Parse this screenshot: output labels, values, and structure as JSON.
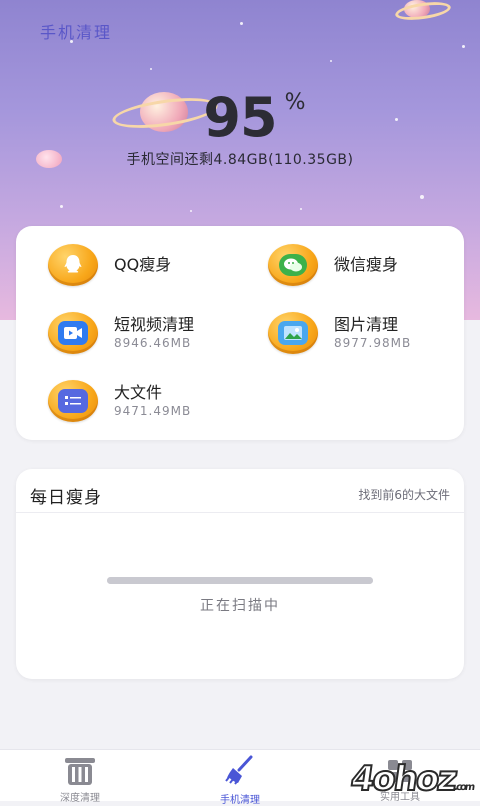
{
  "header": {
    "app_title": "手机清理",
    "percent": "95",
    "percent_sign": "%",
    "storage_text": "手机空间还剩4.84GB(110.35GB)"
  },
  "features": [
    {
      "name": "QQ瘦身",
      "size": "",
      "icon": "qq-icon"
    },
    {
      "name": "微信瘦身",
      "size": "",
      "icon": "wechat-icon"
    },
    {
      "name": "短视频清理",
      "size": "8946.46MB",
      "icon": "video-icon"
    },
    {
      "name": "图片清理",
      "size": "8977.98MB",
      "icon": "image-icon"
    },
    {
      "name": "大文件",
      "size": "9471.49MB",
      "icon": "large-file-icon"
    }
  ],
  "daily": {
    "title": "每日瘦身",
    "subtitle": "找到前6的大文件",
    "progress": 1.0,
    "status": "正在扫描中"
  },
  "nav": {
    "tabs": [
      {
        "label": "深度清理",
        "icon": "trash-icon",
        "active": false
      },
      {
        "label": "手机清理",
        "icon": "broom-icon",
        "active": true
      },
      {
        "label": "实用工具",
        "icon": "tools-icon",
        "active": false
      }
    ],
    "active_color": "#4a56d6",
    "inactive_color": "#8a8a92"
  },
  "watermark": {
    "text": "4ohoz",
    "suffix": ".com"
  },
  "colors": {
    "accent": "#f8a71a",
    "hero_top": "#8f84d0",
    "hero_bottom": "#e7b9df"
  }
}
